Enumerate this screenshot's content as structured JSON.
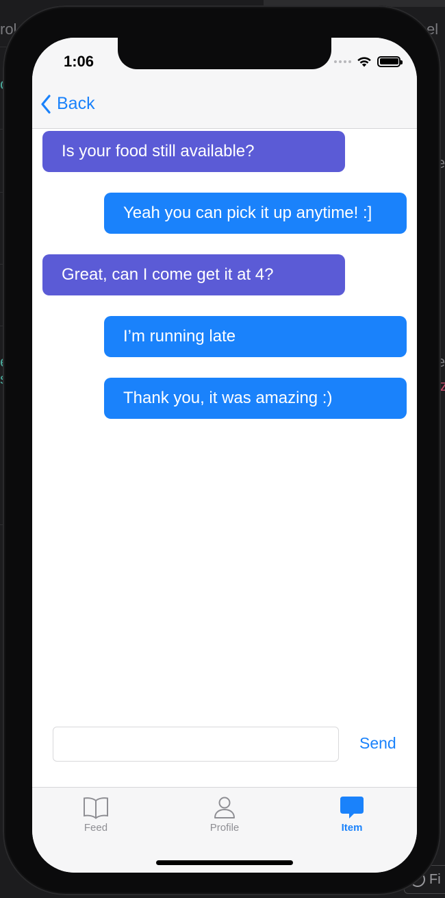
{
  "background": {
    "left_text_1": "rol",
    "right_text_1": "cel",
    "left_text_2": "o",
    "left_text_3": "e",
    "left_text_4": "s",
    "right_text_2": "e",
    "right_text_3": "e",
    "right_text_4": "iz",
    "filter_label": "Fi"
  },
  "status_bar": {
    "time": "1:06"
  },
  "nav": {
    "back_label": "Back"
  },
  "messages": [
    {
      "text": "Is your food still available?",
      "direction": "received"
    },
    {
      "text": "Yeah you can pick it up anytime! :]",
      "direction": "sent"
    },
    {
      "text": "Great, can I come get it at 4?",
      "direction": "received"
    },
    {
      "text": "I’m running late",
      "direction": "sent"
    },
    {
      "text": "Thank you, it was amazing :)",
      "direction": "sent"
    }
  ],
  "composer": {
    "input_value": "",
    "send_label": "Send"
  },
  "tabs": [
    {
      "label": "Feed",
      "icon": "book-icon",
      "active": false
    },
    {
      "label": "Profile",
      "icon": "person-icon",
      "active": false
    },
    {
      "label": "Item",
      "icon": "message-bubble-icon",
      "active": true
    }
  ],
  "colors": {
    "accent": "#1a82fb",
    "received_bubble": "#5b5bd6",
    "sent_bubble": "#1a82fb"
  }
}
